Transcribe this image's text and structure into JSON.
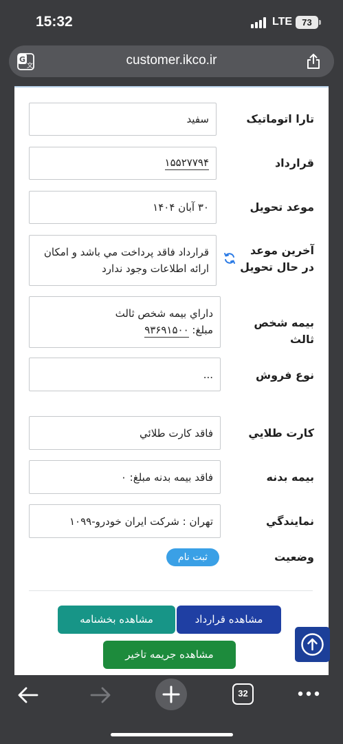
{
  "status_bar": {
    "time": "15:32",
    "network": "LTE",
    "battery": "73"
  },
  "browser": {
    "url": "customer.ikco.ir",
    "tab_count": "32"
  },
  "form": {
    "rows": [
      {
        "label": "تارا اتوماتيک",
        "value": "سفيد"
      },
      {
        "label": "قرارداد",
        "value": "۱۵۵۲۷۷۹۴"
      },
      {
        "label": "موعد تحويل",
        "value": "۳۰ آبان ۱۴۰۴"
      },
      {
        "label": "آخرين موعد در حال تحويل",
        "value": "قرارداد فاقد پرداخت مي باشد و امکان ارائه اطلاعات وجود ندارد"
      },
      {
        "label": "بيمه شخص ثالث",
        "value_line1": "داراي بيمه شخص ثالث",
        "value_line2_prefix": "مبلغ:",
        "value_line2_amount": "۹۳۶۹۱۵۰۰"
      },
      {
        "label": "نوع فروش",
        "value": "..."
      },
      {
        "label": "کارت طلايي",
        "value": "فاقد کارت طلائي"
      },
      {
        "label": "بيمه بدنه",
        "value": "فاقد بيمه بدنه مبلغ: ۰"
      },
      {
        "label": "نمايندگي",
        "value": "تهران : شرکت ايران خودرو-۱۰۹۹"
      },
      {
        "label": "وضعيت",
        "badge": "ثبت نام"
      }
    ]
  },
  "buttons": {
    "view_contract": "مشاهده قرارداد",
    "view_circular": "مشاهده بخشنامه",
    "view_penalty": "مشاهده جريمه تاخير"
  },
  "colors": {
    "contract_button": "#1f3fa3",
    "circular_button": "#179587",
    "penalty_button": "#1d8b3c",
    "status_badge": "#3aa0e6",
    "scroll_top_button": "#1c3f99"
  },
  "icons": [
    "translate-icon",
    "share-icon",
    "refresh-icon",
    "arrow-up-circle-icon",
    "back-arrow-icon",
    "forward-arrow-icon",
    "new-tab-icon",
    "tabs-icon",
    "more-icon"
  ]
}
